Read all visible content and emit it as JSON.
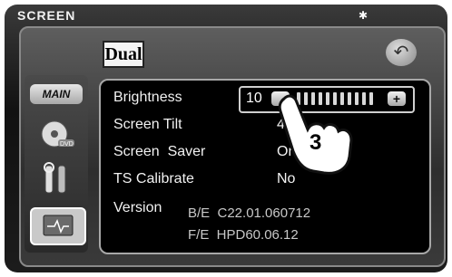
{
  "header": {
    "title": "SCREEN",
    "logo": "Dual",
    "bluetooth_icon": "bluetooth-icon",
    "back_icon": "back-arrow-icon"
  },
  "sidebar": {
    "main_label": "MAIN",
    "items": [
      "disc-dvd-icon",
      "tools-icon",
      "screen-icon"
    ]
  },
  "settings": {
    "brightness": {
      "label": "Brightness",
      "value": "10",
      "level": 10
    },
    "tilt": {
      "label": "Screen Tilt",
      "value": "4"
    },
    "saver": {
      "label": "Screen  Saver",
      "value": "On"
    },
    "calibrate": {
      "label": "TS Calibrate",
      "value": "No"
    },
    "version": {
      "label": "Version",
      "be": "B/E  C22.01.060712",
      "fe": "F/E  HPD60.06.12"
    }
  },
  "annotation": {
    "step": "3"
  }
}
